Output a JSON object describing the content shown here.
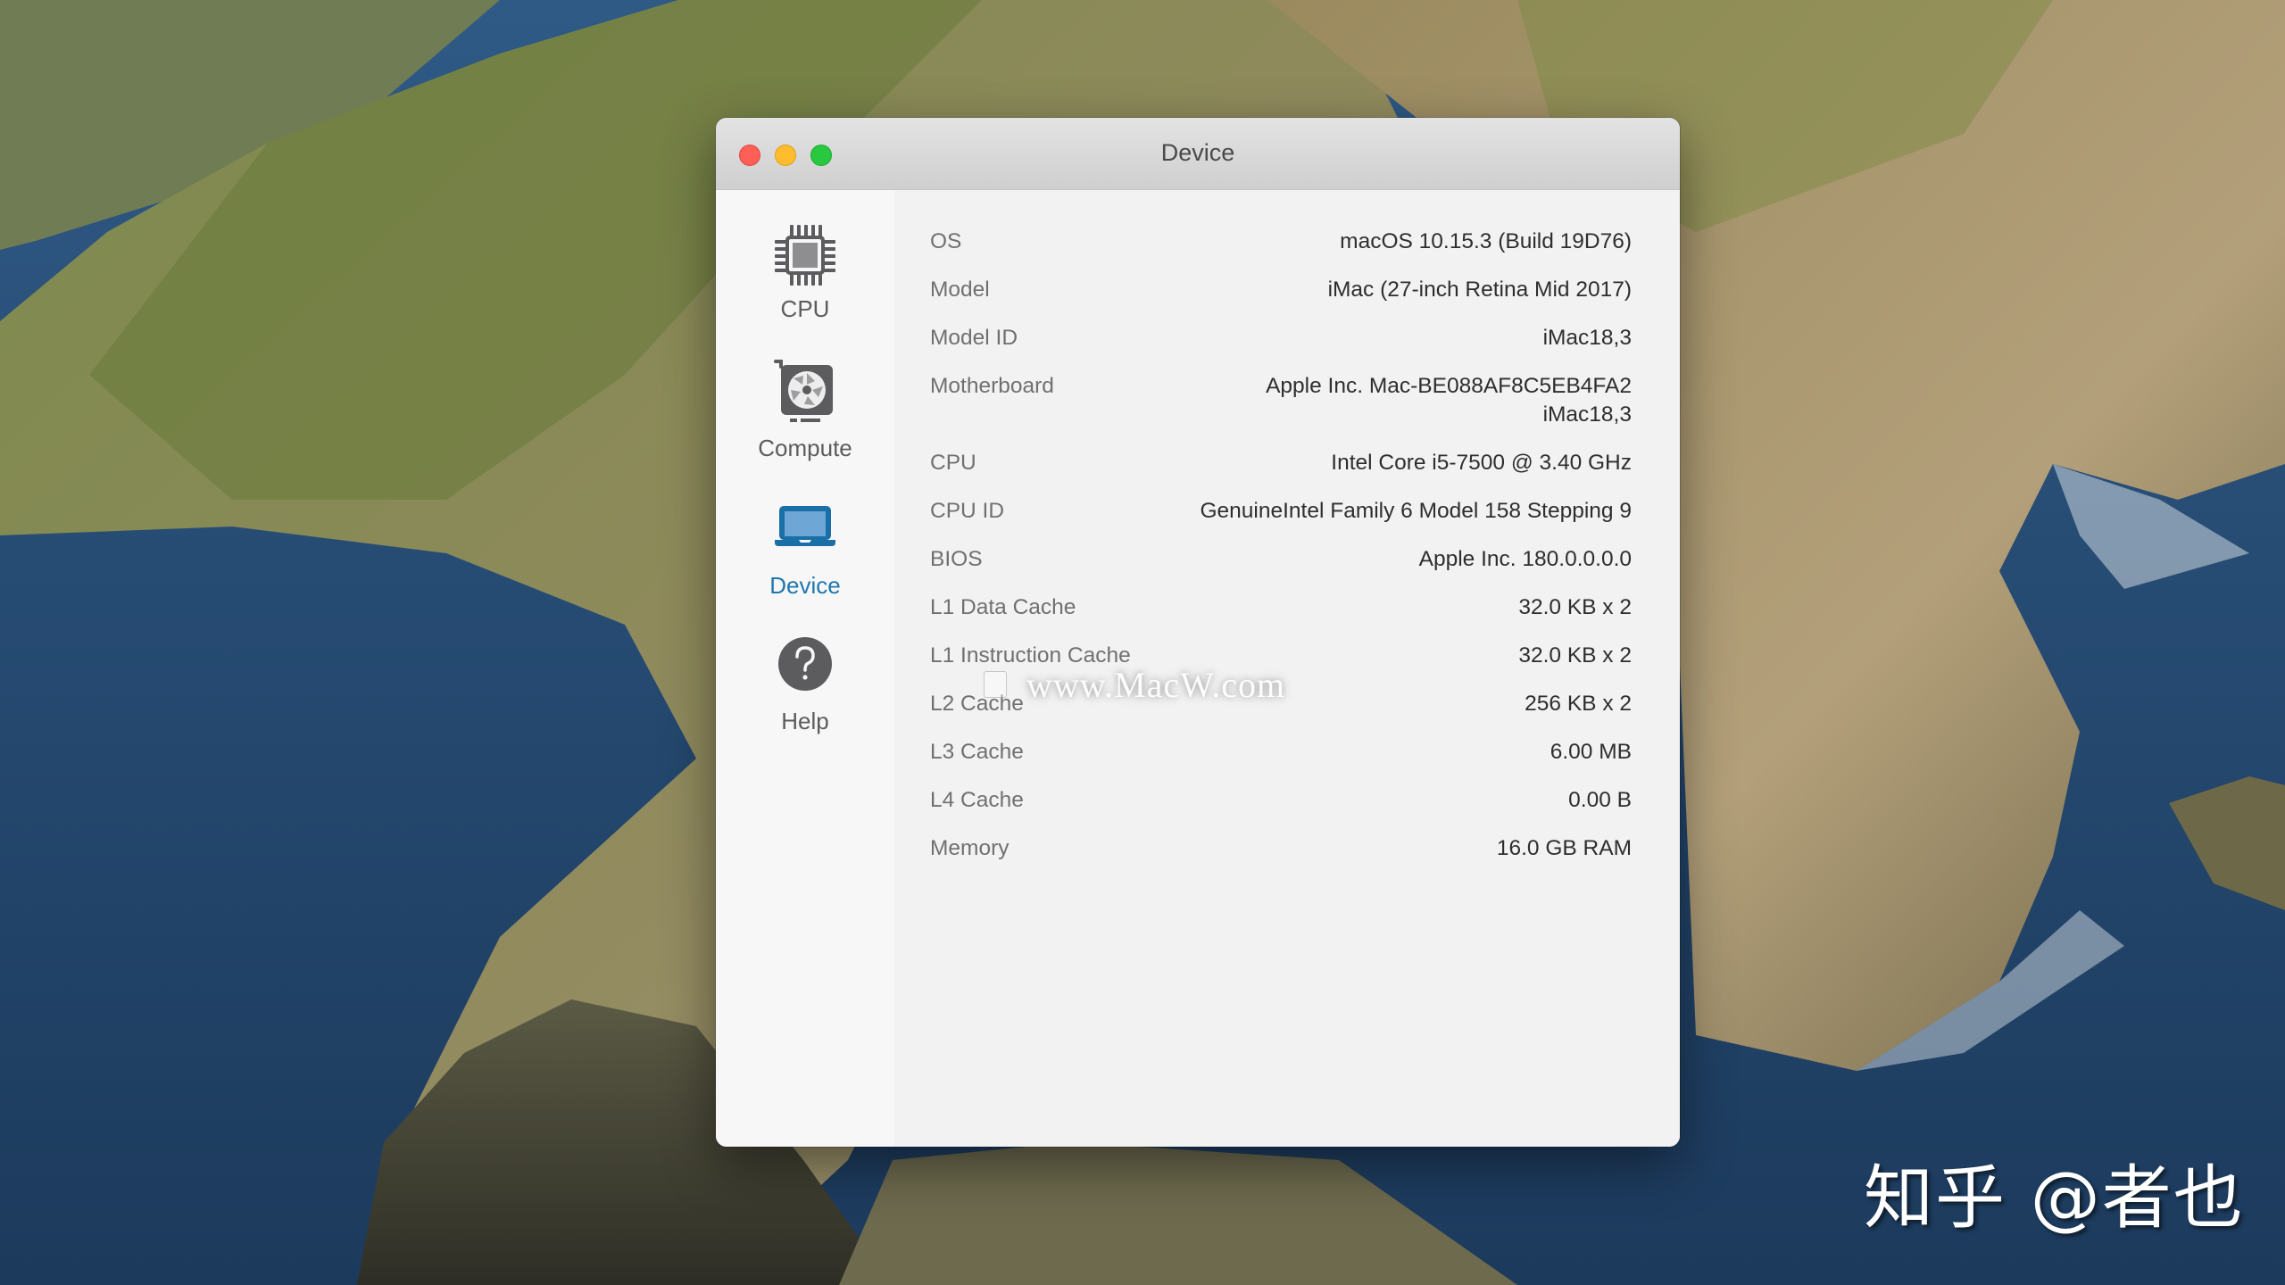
{
  "desktop": {
    "watermark_text": "知乎 @者也"
  },
  "window": {
    "title": "Device",
    "traffic_lights": {
      "close": "close-button",
      "minimize": "minimize-button",
      "zoom": "zoom-button"
    }
  },
  "sidebar": {
    "active": "device",
    "accent_color": "#1f77ad",
    "items": [
      {
        "id": "cpu",
        "label": "CPU",
        "icon": "cpu-chip-icon"
      },
      {
        "id": "compute",
        "label": "Compute",
        "icon": "gpu-card-icon"
      },
      {
        "id": "device",
        "label": "Device",
        "icon": "laptop-icon"
      },
      {
        "id": "help",
        "label": "Help",
        "icon": "help-icon"
      }
    ]
  },
  "device_info": [
    {
      "label": "OS",
      "value": "macOS 10.15.3 (Build 19D76)"
    },
    {
      "label": "Model",
      "value": "iMac (27-inch Retina Mid 2017)"
    },
    {
      "label": "Model ID",
      "value": "iMac18,3"
    },
    {
      "label": "Motherboard",
      "value": "Apple Inc. Mac-BE088AF8C5EB4FA2",
      "value_line2": "iMac18,3"
    },
    {
      "label": "CPU",
      "value": "Intel Core i5-7500 @ 3.40 GHz"
    },
    {
      "label": "CPU ID",
      "value": "GenuineIntel Family 6 Model 158 Stepping 9"
    },
    {
      "label": "BIOS",
      "value": "Apple Inc. 180.0.0.0.0"
    },
    {
      "label": "L1 Data Cache",
      "value": "32.0 KB x 2"
    },
    {
      "label": "L1 Instruction Cache",
      "value": "32.0 KB x 2"
    },
    {
      "label": "L2 Cache",
      "value": "256 KB x 2"
    },
    {
      "label": "L3 Cache",
      "value": "6.00 MB"
    },
    {
      "label": "L4 Cache",
      "value": "0.00 B"
    },
    {
      "label": "Memory",
      "value": "16.0 GB RAM"
    }
  ],
  "overlay_watermark": "www.MacW.com"
}
